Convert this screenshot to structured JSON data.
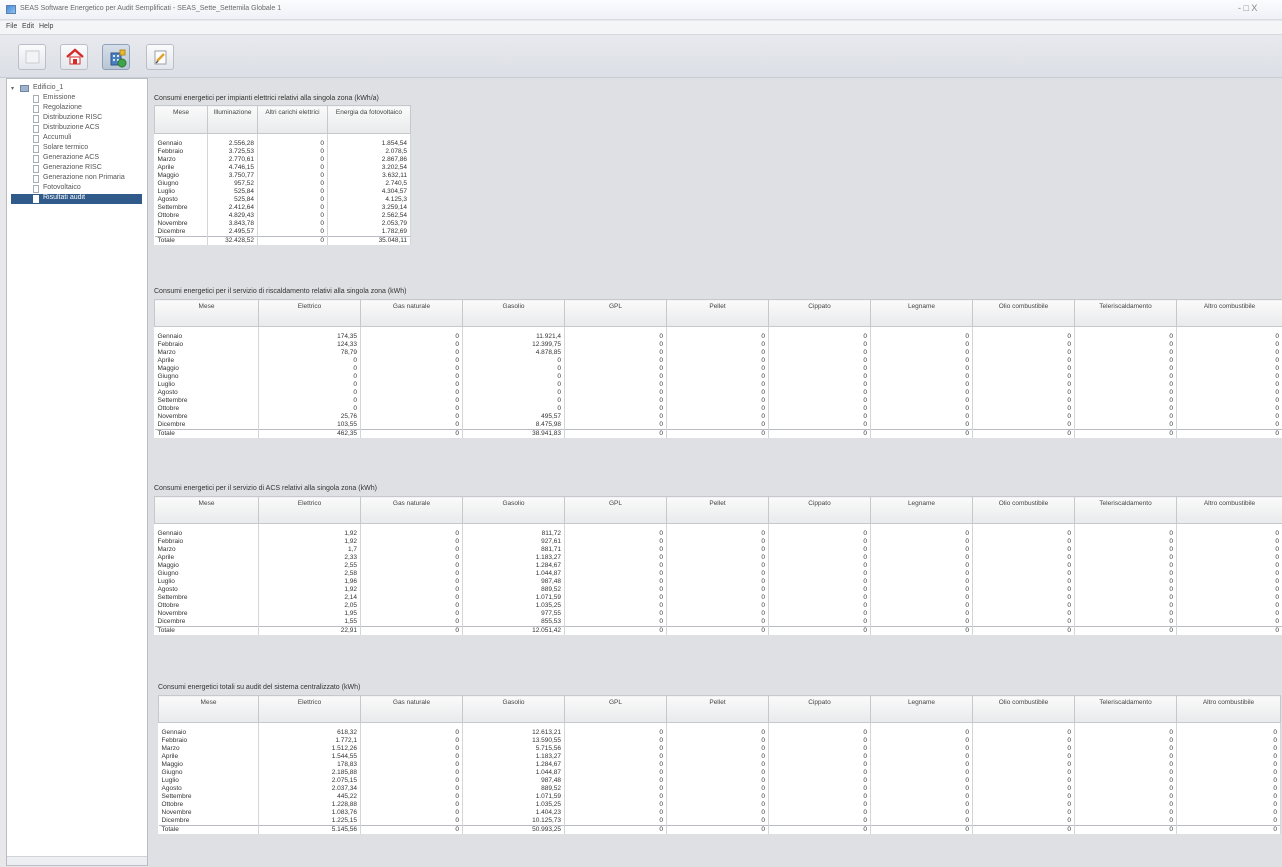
{
  "window": {
    "title": "SEAS Software Energetico per Audit Semplificati - SEAS_Sette_Settemila Globale 1",
    "controls": "- □ X"
  },
  "menu": [
    "File",
    "Edit",
    "Help"
  ],
  "toolbar": {
    "buttons": [
      {
        "name": "blank-tool-icon"
      },
      {
        "name": "home-icon"
      },
      {
        "name": "building-icon"
      },
      {
        "name": "edit-document-icon"
      }
    ]
  },
  "sidebar": {
    "root": "Edificio_1",
    "items": [
      "Emissione",
      "Regolazione",
      "Distribuzione RISC",
      "Distribuzione ACS",
      "Accumuli",
      "Solare termico",
      "Generazione ACS",
      "Generazione RISC",
      "Generazione non Primaria",
      "Fotovoltaico",
      "Risultati audit"
    ],
    "selected_index": 10
  },
  "months": [
    "Gennaio",
    "Febbraio",
    "Marzo",
    "Aprile",
    "Maggio",
    "Giugno",
    "Luglio",
    "Agosto",
    "Settembre",
    "Ottobre",
    "Novembre",
    "Dicembre",
    "Totale"
  ],
  "fuel_columns": [
    "Mese",
    "Elettrico",
    "Gas naturale",
    "Gasolio",
    "GPL",
    "Pellet",
    "Cippato",
    "Legname",
    "Olio combustibile",
    "Teleriscaldamento",
    "Altro combustibile"
  ],
  "section1": {
    "title": "Consumi energetici per impianti elettrici relativi alla singola zona (kWh/a)",
    "columns": [
      "Mese",
      "Illuminazione",
      "Altri carichi elettrici",
      "Energia da fotovoltaico"
    ],
    "rows": [
      [
        "2.556,28",
        "0",
        "1.854,54"
      ],
      [
        "3.725,53",
        "0",
        "2.078,5"
      ],
      [
        "2.770,61",
        "0",
        "2.867,86"
      ],
      [
        "4.746,15",
        "0",
        "3.202,54"
      ],
      [
        "3.750,77",
        "0",
        "3.632,11"
      ],
      [
        "957,52",
        "0",
        "2.740,5"
      ],
      [
        "525,84",
        "0",
        "4.304,57"
      ],
      [
        "525,84",
        "0",
        "4.125,3"
      ],
      [
        "2.412,64",
        "0",
        "3.259,14"
      ],
      [
        "4.829,43",
        "0",
        "2.562,54"
      ],
      [
        "3.843,78",
        "0",
        "2.053,79"
      ],
      [
        "2.495,57",
        "0",
        "1.782,69"
      ],
      [
        "32.428,52",
        "0",
        "35.048,11"
      ]
    ]
  },
  "section2": {
    "title": "Consumi energetici per il servizio di riscaldamento relativi alla singola zona (kWh)",
    "rows": [
      [
        "174,35",
        "0",
        "11.921,4",
        "0",
        "0",
        "0",
        "0",
        "0",
        "0",
        "0"
      ],
      [
        "124,33",
        "0",
        "12.399,75",
        "0",
        "0",
        "0",
        "0",
        "0",
        "0",
        "0"
      ],
      [
        "78,79",
        "0",
        "4.878,85",
        "0",
        "0",
        "0",
        "0",
        "0",
        "0",
        "0"
      ],
      [
        "0",
        "0",
        "0",
        "0",
        "0",
        "0",
        "0",
        "0",
        "0",
        "0"
      ],
      [
        "0",
        "0",
        "0",
        "0",
        "0",
        "0",
        "0",
        "0",
        "0",
        "0"
      ],
      [
        "0",
        "0",
        "0",
        "0",
        "0",
        "0",
        "0",
        "0",
        "0",
        "0"
      ],
      [
        "0",
        "0",
        "0",
        "0",
        "0",
        "0",
        "0",
        "0",
        "0",
        "0"
      ],
      [
        "0",
        "0",
        "0",
        "0",
        "0",
        "0",
        "0",
        "0",
        "0",
        "0"
      ],
      [
        "0",
        "0",
        "0",
        "0",
        "0",
        "0",
        "0",
        "0",
        "0",
        "0"
      ],
      [
        "0",
        "0",
        "0",
        "0",
        "0",
        "0",
        "0",
        "0",
        "0",
        "0"
      ],
      [
        "25,76",
        "0",
        "495,57",
        "0",
        "0",
        "0",
        "0",
        "0",
        "0",
        "0"
      ],
      [
        "103,55",
        "0",
        "8.475,98",
        "0",
        "0",
        "0",
        "0",
        "0",
        "0",
        "0"
      ],
      [
        "462,35",
        "0",
        "38.941,83",
        "0",
        "0",
        "0",
        "0",
        "0",
        "0",
        "0"
      ]
    ]
  },
  "section3": {
    "title": "Consumi energetici per il servizio di ACS relativi alla singola zona (kWh)",
    "rows": [
      [
        "1,92",
        "0",
        "811,72",
        "0",
        "0",
        "0",
        "0",
        "0",
        "0",
        "0"
      ],
      [
        "1,92",
        "0",
        "927,61",
        "0",
        "0",
        "0",
        "0",
        "0",
        "0",
        "0"
      ],
      [
        "1,7",
        "0",
        "881,71",
        "0",
        "0",
        "0",
        "0",
        "0",
        "0",
        "0"
      ],
      [
        "2,33",
        "0",
        "1.183,27",
        "0",
        "0",
        "0",
        "0",
        "0",
        "0",
        "0"
      ],
      [
        "2,55",
        "0",
        "1.284,67",
        "0",
        "0",
        "0",
        "0",
        "0",
        "0",
        "0"
      ],
      [
        "2,58",
        "0",
        "1.044,87",
        "0",
        "0",
        "0",
        "0",
        "0",
        "0",
        "0"
      ],
      [
        "1,96",
        "0",
        "987,48",
        "0",
        "0",
        "0",
        "0",
        "0",
        "0",
        "0"
      ],
      [
        "1,92",
        "0",
        "889,52",
        "0",
        "0",
        "0",
        "0",
        "0",
        "0",
        "0"
      ],
      [
        "2,14",
        "0",
        "1.071,59",
        "0",
        "0",
        "0",
        "0",
        "0",
        "0",
        "0"
      ],
      [
        "2,05",
        "0",
        "1.035,25",
        "0",
        "0",
        "0",
        "0",
        "0",
        "0",
        "0"
      ],
      [
        "1,95",
        "0",
        "977,55",
        "0",
        "0",
        "0",
        "0",
        "0",
        "0",
        "0"
      ],
      [
        "1,55",
        "0",
        "855,53",
        "0",
        "0",
        "0",
        "0",
        "0",
        "0",
        "0"
      ],
      [
        "22,91",
        "0",
        "12.051,42",
        "0",
        "0",
        "0",
        "0",
        "0",
        "0",
        "0"
      ]
    ]
  },
  "section4": {
    "title": "Consumi energetici totali su audit del sistema centralizzato (kWh)",
    "rows": [
      [
        "618,32",
        "0",
        "12.613,21",
        "0",
        "0",
        "0",
        "0",
        "0",
        "0",
        "0"
      ],
      [
        "1.772,1",
        "0",
        "13.590,55",
        "0",
        "0",
        "0",
        "0",
        "0",
        "0",
        "0"
      ],
      [
        "1.512,26",
        "0",
        "5.715,56",
        "0",
        "0",
        "0",
        "0",
        "0",
        "0",
        "0"
      ],
      [
        "1.544,55",
        "0",
        "1.183,27",
        "0",
        "0",
        "0",
        "0",
        "0",
        "0",
        "0"
      ],
      [
        "178,83",
        "0",
        "1.284,67",
        "0",
        "0",
        "0",
        "0",
        "0",
        "0",
        "0"
      ],
      [
        "2.185,88",
        "0",
        "1.044,87",
        "0",
        "0",
        "0",
        "0",
        "0",
        "0",
        "0"
      ],
      [
        "2.075,15",
        "0",
        "987,48",
        "0",
        "0",
        "0",
        "0",
        "0",
        "0",
        "0"
      ],
      [
        "2.037,34",
        "0",
        "889,52",
        "0",
        "0",
        "0",
        "0",
        "0",
        "0",
        "0"
      ],
      [
        "445,22",
        "0",
        "1.071,59",
        "0",
        "0",
        "0",
        "0",
        "0",
        "0",
        "0"
      ],
      [
        "1.228,88",
        "0",
        "1.035,25",
        "0",
        "0",
        "0",
        "0",
        "0",
        "0",
        "0"
      ],
      [
        "1.083,76",
        "0",
        "1.404,23",
        "0",
        "0",
        "0",
        "0",
        "0",
        "0",
        "0"
      ],
      [
        "1.225,15",
        "0",
        "10.125,73",
        "0",
        "0",
        "0",
        "0",
        "0",
        "0",
        "0"
      ],
      [
        "5.145,56",
        "0",
        "50.993,25",
        "0",
        "0",
        "0",
        "0",
        "0",
        "0",
        "0"
      ]
    ]
  }
}
